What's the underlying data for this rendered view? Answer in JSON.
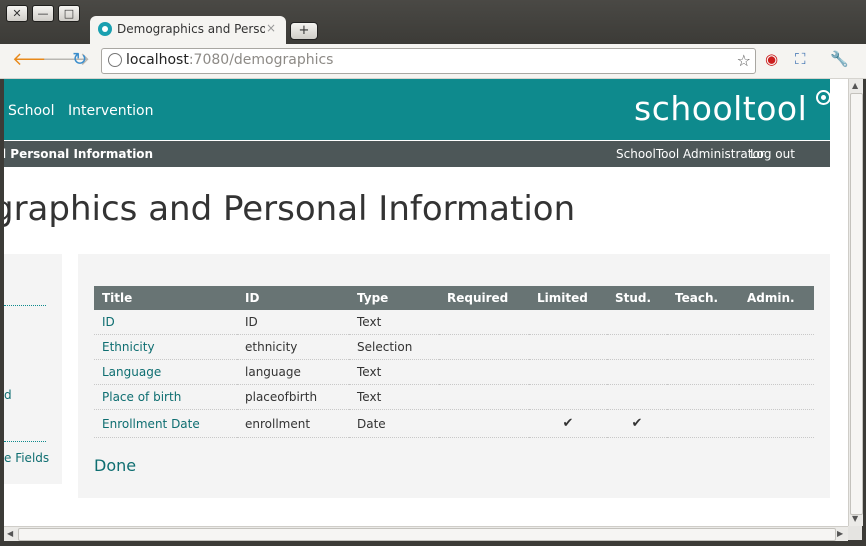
{
  "browser": {
    "tab_title": "Demographics and Personal Information",
    "tab_close": "×",
    "new_tab": "+",
    "url_host": "localhost",
    "url_rest": ":7080/demographics",
    "window_buttons": {
      "close": "✕",
      "minimize": "—",
      "maximize": "□"
    },
    "icons": {
      "back": "🡐",
      "forward": "🡒",
      "reload": "↻",
      "star": "☆",
      "opera": "◉",
      "fullscreen": "⛶",
      "wrench": "🔧"
    }
  },
  "header": {
    "nav": [
      "School",
      "Intervention"
    ],
    "logo": "schooltool"
  },
  "subbar": {
    "title": "l Personal Information",
    "user": "SchoolTool Administrator",
    "logout": "Log out"
  },
  "page": {
    "title": "graphics and Personal Information"
  },
  "sidebar": {
    "items": [
      "d",
      "e Fields"
    ]
  },
  "table": {
    "headers": [
      "Title",
      "ID",
      "Type",
      "Required",
      "Limited",
      "Stud.",
      "Teach.",
      "Admin."
    ],
    "rows": [
      {
        "title": "ID",
        "id": "ID",
        "type": "Text",
        "required": "",
        "limited": "",
        "stud": "",
        "teach": "",
        "admin": ""
      },
      {
        "title": "Ethnicity",
        "id": "ethnicity",
        "type": "Selection",
        "required": "",
        "limited": "",
        "stud": "",
        "teach": "",
        "admin": ""
      },
      {
        "title": "Language",
        "id": "language",
        "type": "Text",
        "required": "",
        "limited": "",
        "stud": "",
        "teach": "",
        "admin": ""
      },
      {
        "title": "Place of birth",
        "id": "placeofbirth",
        "type": "Text",
        "required": "",
        "limited": "",
        "stud": "",
        "teach": "",
        "admin": ""
      },
      {
        "title": "Enrollment Date",
        "id": "enrollment",
        "type": "Date",
        "required": "",
        "limited": "✔",
        "stud": "✔",
        "teach": "",
        "admin": ""
      }
    ]
  },
  "done": "Done"
}
